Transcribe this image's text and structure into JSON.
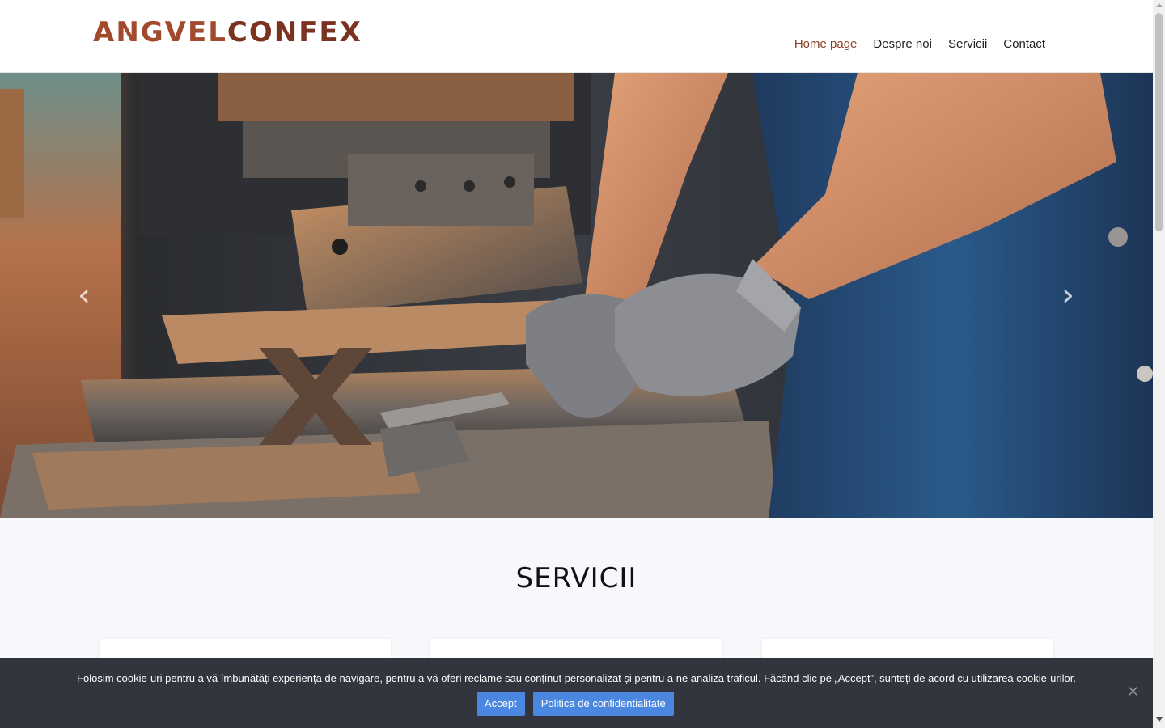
{
  "header": {
    "logo_part1": "ANGVEL",
    "logo_part2": "CONFEX",
    "nav": [
      {
        "label": "Home page",
        "active": true
      },
      {
        "label": "Despre noi",
        "active": false
      },
      {
        "label": "Servicii",
        "active": false
      },
      {
        "label": "Contact",
        "active": false
      }
    ]
  },
  "hero": {
    "image": "workshop-hands-gloves-metal-press",
    "prev_icon": "chevron-left-icon",
    "next_icon": "chevron-right-icon",
    "prev_glyph": "‹",
    "next_glyph": "›"
  },
  "services": {
    "title": "SERVICII"
  },
  "cookie": {
    "text": "Folosim cookie-uri pentru a vă îmbunătăți experiența de navigare, pentru a vă oferi reclame sau conținut personalizat și pentru a ne analiza traficul. Făcând clic pe „Accept”, sunteți de acord cu utilizarea cookie-urilor.",
    "accept_label": "Accept",
    "policy_label": "Politica de confidentialitate",
    "close_glyph": "✕"
  },
  "colors": {
    "brand_light": "#a14a2e",
    "brand_dark": "#7a3221",
    "nav_active": "#8c3b26",
    "button": "#4a87e0",
    "cookie_bg": "#32353d"
  }
}
